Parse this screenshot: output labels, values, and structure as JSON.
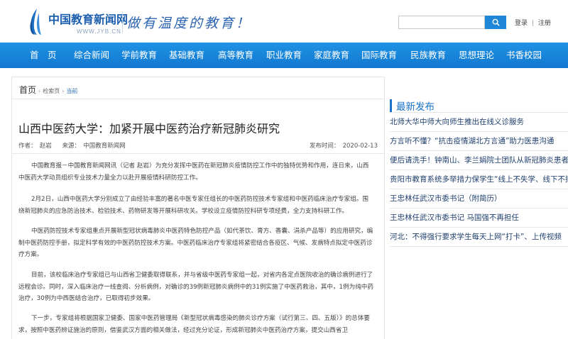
{
  "header": {
    "brand_cn": "中国教育新闻网",
    "brand_en": "WWW.JYB.CN",
    "slogan": "做有温度的教育！",
    "search_placeholder": "",
    "login": "登录",
    "sep": "|",
    "register": "注册"
  },
  "colors": {
    "nav_bg": "#1583d8",
    "brand": "#1d5fae",
    "accent": "#1b73c8"
  },
  "nav": {
    "items": [
      "首　页",
      "综合新闻",
      "学前教育",
      "基础教育",
      "高等教育",
      "职业教育",
      "家庭教育",
      "国际教育",
      "民族教育",
      "思想理论",
      "书香校园"
    ]
  },
  "breadcrumb": {
    "home": "首页",
    "sep": "›",
    "level1": "检索页",
    "current": "当前"
  },
  "article": {
    "title": "山西中医药大学：加紧开展中医药治疗新冠肺炎研究",
    "author": "作者：　赵岩",
    "source": "来源：　中国教育新闻网",
    "date": "发布时间：　2020-02-13",
    "paragraphs": [
      "中国教育报－中国教育新闻网讯（记者 赵岩）为充分发挥中医药在新冠肺炎疫情防控工作中的独特优势和作用，连日来，山西中医药大学动员组织专业技术力量全力以赴开展疫情科研防控工作。",
      "2月2日，山西中医药大学分别成立了由经验丰富的著名中医专家任组长的中医药防控技术专家组和中医药临床治疗专家组。围绕新冠肺炎的应急防治技术、检验技术、药物研发等开展科研攻关。学校设立疫情防控科研专项经费，全力支持科研工作。",
      "中医药防控技术专家组重点开展新型冠状病毒肺炎中医药特色防控产品（如代茶饮、膏方、香囊、涓杀产品等）的应用研究，编制中医药防控手册，拟定科学有效的中医药防控技术方案。中医药临床治疗专家组将紧密结合各疫区、气候、发病特点拟定中医药诊疗方案。",
      "目前，该校临床治疗专家组已与山西省卫健委取得联系，并与省级中医药专家组一起，对省内各定点医院收治的确诊病例进行了远程会诊。同时，深入临床治疗一线查阅、分析病例，对确诊的39例新冠肺炎病例中的31例实施了中医药救治，其中，1例为纯中药治疗，30例为中西医结合治疗，已取得初步效果。",
      "下一步，专家组将根据国家卫健委、国家中医药管理局《新型冠状病毒感染的肺炎诊疗方案（试行第三、四、五版）》的总体要求，按照中医药辨证施治的原则，借鉴武汉方面的相关做法，经过充分论证，形成新冠肺炎中医药治疗方案，提交山西省卫"
    ]
  },
  "sidebar": {
    "heading": "最新发布",
    "items": [
      "北师大华中师大向师生推出在线义诊服务",
      "方言听不懂？“抗击疫情湖北方言通”助力医患沟通",
      "便后请洗手！钟南山、李兰娟院士团队从新冠肺炎患者粪便中分离出病毒",
      "贵阳市教育系统多举措力保学生“线上不失学、线下不掉队”",
      "王忠林任武汉市委书记（附简历）",
      "王忠林任武汉市委书记 马国强不再担任",
      "河北：不得强行要求学生每天上网“打卡”、上传视频"
    ]
  }
}
